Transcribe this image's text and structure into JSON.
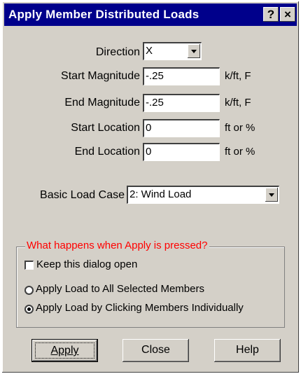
{
  "window": {
    "title": "Apply Member Distributed Loads",
    "help_glyph": "?",
    "close_glyph": "×"
  },
  "form": {
    "direction": {
      "label": "Direction",
      "value": "X"
    },
    "start_magnitude": {
      "label": "Start Magnitude",
      "value": "-.25",
      "unit": "k/ft, F"
    },
    "end_magnitude": {
      "label": "End Magnitude",
      "value": "-.25",
      "unit": "k/ft, F"
    },
    "start_location": {
      "label": "Start Location",
      "value": "0",
      "unit": "ft or %"
    },
    "end_location": {
      "label": "End Location",
      "value": "0",
      "unit": "ft or %"
    },
    "load_case": {
      "label": "Basic Load Case",
      "value": "2: Wind Load"
    }
  },
  "group": {
    "title": "What happens when Apply is pressed?",
    "keep_open": {
      "label": "Keep this dialog open",
      "checked": false
    },
    "options": [
      {
        "label": "Apply Load to All Selected Members",
        "selected": false
      },
      {
        "label": "Apply Load by Clicking Members Individually",
        "selected": true
      }
    ]
  },
  "buttons": {
    "apply": "Apply",
    "close": "Close",
    "help": "Help"
  },
  "colors": {
    "titlebar": "#00008b",
    "dialog_bg": "#d4d0c8",
    "group_title": "#ff0000"
  }
}
